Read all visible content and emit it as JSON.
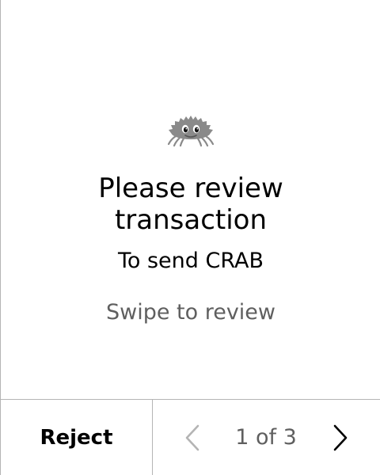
{
  "review": {
    "logo_icon": "crab-icon",
    "title_line1": "Please review",
    "title_line2": "transaction",
    "subtitle": "To send CRAB",
    "hint": "Swipe to review"
  },
  "footer": {
    "reject_label": "Reject",
    "prev_icon": "chevron-left-icon",
    "next_icon": "chevron-right-icon",
    "page_indicator": "1 of 3",
    "current_page": 1,
    "total_pages": 3
  },
  "colors": {
    "text": "#000000",
    "muted_text": "#5f5f5f",
    "divider": "#b4b4b4",
    "disabled_icon": "#b4b4b4",
    "logo_gray": "#8a8a8a"
  }
}
